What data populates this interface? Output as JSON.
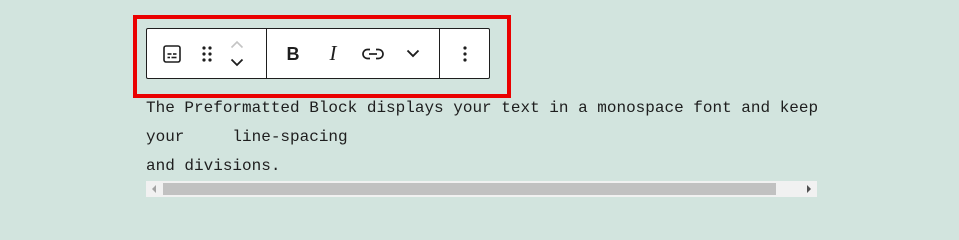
{
  "toolbar": {
    "block_type_icon": "preformatted-icon",
    "drag_icon": "drag-handle-icon",
    "move_up_icon": "chevron-up-icon",
    "move_down_icon": "chevron-down-icon",
    "bold_label": "B",
    "italic_label": "I",
    "link_icon": "link-icon",
    "more_formats_icon": "chevron-down-icon",
    "options_icon": "more-vertical-icon"
  },
  "preformatted": {
    "text": "The Preformatted Block displays your text in a monospace font and keeps\nyour     line-spacing\nand divisions."
  },
  "colors": {
    "page_background": "#d2e4de",
    "highlight": "#ea0000",
    "toolbar_border": "#1e1e1e",
    "text": "#1e1e1e",
    "scrollbar_track": "#f1f1f1",
    "scrollbar_thumb": "#c1c1c1"
  }
}
